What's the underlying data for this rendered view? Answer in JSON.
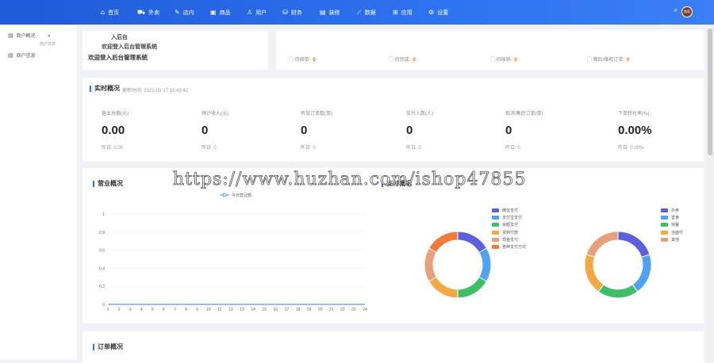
{
  "nav": {
    "items": [
      {
        "label": "首页",
        "icon": "home-icon",
        "glyph": "⌂"
      },
      {
        "label": "外卖",
        "icon": "delivery-icon",
        "glyph": "⛟"
      },
      {
        "label": "店内",
        "icon": "store-icon",
        "glyph": "✎"
      },
      {
        "label": "商品",
        "icon": "goods-icon",
        "glyph": "▣"
      },
      {
        "label": "用户",
        "icon": "user-icon",
        "glyph": "♙"
      },
      {
        "label": "财务",
        "icon": "finance-icon",
        "glyph": "⛁"
      },
      {
        "label": "装修",
        "icon": "decorate-icon",
        "glyph": "▤"
      },
      {
        "label": "数据",
        "icon": "data-icon",
        "glyph": "⟋"
      },
      {
        "label": "应用",
        "icon": "apps-icon",
        "glyph": "⊞"
      },
      {
        "label": "设置",
        "icon": "settings-icon",
        "glyph": "⚙"
      }
    ],
    "avatar_text": "商家"
  },
  "sidebar": {
    "items": [
      {
        "label": "商户概况",
        "sub": "商户信息"
      },
      {
        "label": "商户信息"
      }
    ]
  },
  "welcome": {
    "line1": "入后台",
    "line2": "欢迎登入后台管理系统",
    "line3": "欢迎登入后台管理系统"
  },
  "orders_overview": {
    "items": [
      {
        "label": "待接单:",
        "value": "0"
      },
      {
        "label": "待完成:",
        "value": "0"
      },
      {
        "label": "待核销:",
        "value": "0"
      },
      {
        "label": "售后/维权订单:",
        "value": "0"
      }
    ]
  },
  "realtime": {
    "title": "实时概况",
    "updated": "更新时间: 2022-03-17 15:49:42",
    "stats": [
      {
        "label": "营业总额(元)",
        "value": "0.00",
        "yesterday": "昨日: 0.00"
      },
      {
        "label": "预计收入(元)",
        "value": "0",
        "yesterday": "昨日: 0"
      },
      {
        "label": "有效订单数(单)",
        "value": "0",
        "yesterday": "昨日: 0"
      },
      {
        "label": "支付人数(人)",
        "value": "0",
        "yesterday": "昨日: 0"
      },
      {
        "label": "取消/售后订单(单)",
        "value": "0",
        "yesterday": "昨日: 0"
      },
      {
        "label": "下单转化率(%)",
        "value": "0.00%",
        "yesterday": "昨日: 0.00%"
      }
    ]
  },
  "business": {
    "title": "营业概况",
    "pay_title": "支付概况"
  },
  "order_section": {
    "title": "订单概况"
  },
  "watermark": "https://www.huzhan.com/ishop47855",
  "chart_data": [
    {
      "type": "line",
      "series": [
        {
          "name": "今日营业额",
          "values": [
            0,
            0,
            0,
            0,
            0,
            0,
            0,
            0,
            0,
            0,
            0,
            0,
            0,
            0,
            0,
            0,
            0,
            0,
            0,
            0,
            0,
            0,
            0,
            0
          ]
        }
      ],
      "x": [
        1,
        2,
        3,
        4,
        5,
        6,
        7,
        8,
        9,
        10,
        11,
        12,
        13,
        14,
        15,
        16,
        17,
        18,
        19,
        20,
        21,
        22,
        23,
        24
      ],
      "ylim": [
        0,
        1
      ],
      "yticks": [
        "0",
        "0.2",
        "0.4",
        "0.6",
        "0.8",
        "1"
      ],
      "color": "#5b8ff9"
    },
    {
      "type": "pie",
      "labels": [
        "微信支付",
        "支付宝支付",
        "余额支付",
        "货到付款",
        "现金支付",
        "各种支付方式"
      ],
      "values": [
        1,
        1,
        1,
        1,
        1,
        1
      ],
      "colors": [
        "#5b5fe0",
        "#4fa3f7",
        "#3dbf6a",
        "#f5a742",
        "#e8a07a",
        "#f47a3a"
      ]
    },
    {
      "type": "pie",
      "labels": [
        "外卖",
        "堂食",
        "快餐",
        "当面付",
        "其他"
      ],
      "values": [
        1,
        1,
        1,
        1,
        1
      ],
      "colors": [
        "#5b5fe0",
        "#4fa3f7",
        "#3dbf6a",
        "#f5a742",
        "#e8a07a"
      ]
    }
  ]
}
